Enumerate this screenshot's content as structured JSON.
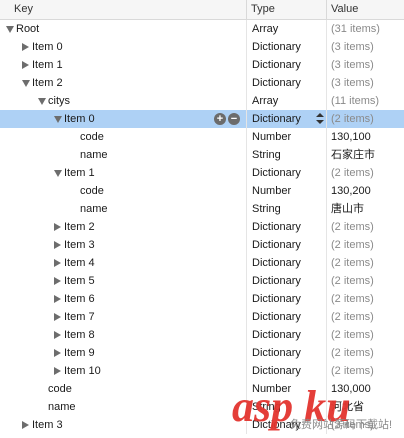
{
  "columns": {
    "key": "Key",
    "type": "Type",
    "value": "Value"
  },
  "rows": [
    {
      "key": "Root",
      "type": "Array",
      "value": "(31 items)",
      "indent": 0,
      "disclosure": "expanded",
      "muted": true
    },
    {
      "key": "Item 0",
      "type": "Dictionary",
      "value": "(3 items)",
      "indent": 1,
      "disclosure": "collapsed",
      "muted": true
    },
    {
      "key": "Item 1",
      "type": "Dictionary",
      "value": "(3 items)",
      "indent": 1,
      "disclosure": "collapsed",
      "muted": true
    },
    {
      "key": "Item 2",
      "type": "Dictionary",
      "value": "(3 items)",
      "indent": 1,
      "disclosure": "expanded",
      "muted": true
    },
    {
      "key": "citys",
      "type": "Array",
      "value": "(11 items)",
      "indent": 2,
      "disclosure": "expanded",
      "muted": true
    },
    {
      "key": "Item 0",
      "type": "Dictionary",
      "value": "(2 items)",
      "indent": 3,
      "disclosure": "expanded",
      "muted": true,
      "selected": true
    },
    {
      "key": "code",
      "type": "Number",
      "value": "130,100",
      "indent": 4,
      "disclosure": "none",
      "muted": false
    },
    {
      "key": "name",
      "type": "String",
      "value": "石家庄市",
      "indent": 4,
      "disclosure": "none",
      "muted": false
    },
    {
      "key": "Item 1",
      "type": "Dictionary",
      "value": "(2 items)",
      "indent": 3,
      "disclosure": "expanded",
      "muted": true
    },
    {
      "key": "code",
      "type": "Number",
      "value": "130,200",
      "indent": 4,
      "disclosure": "none",
      "muted": false
    },
    {
      "key": "name",
      "type": "String",
      "value": "唐山市",
      "indent": 4,
      "disclosure": "none",
      "muted": false
    },
    {
      "key": "Item 2",
      "type": "Dictionary",
      "value": "(2 items)",
      "indent": 3,
      "disclosure": "collapsed",
      "muted": true
    },
    {
      "key": "Item 3",
      "type": "Dictionary",
      "value": "(2 items)",
      "indent": 3,
      "disclosure": "collapsed",
      "muted": true
    },
    {
      "key": "Item 4",
      "type": "Dictionary",
      "value": "(2 items)",
      "indent": 3,
      "disclosure": "collapsed",
      "muted": true
    },
    {
      "key": "Item 5",
      "type": "Dictionary",
      "value": "(2 items)",
      "indent": 3,
      "disclosure": "collapsed",
      "muted": true
    },
    {
      "key": "Item 6",
      "type": "Dictionary",
      "value": "(2 items)",
      "indent": 3,
      "disclosure": "collapsed",
      "muted": true
    },
    {
      "key": "Item 7",
      "type": "Dictionary",
      "value": "(2 items)",
      "indent": 3,
      "disclosure": "collapsed",
      "muted": true
    },
    {
      "key": "Item 8",
      "type": "Dictionary",
      "value": "(2 items)",
      "indent": 3,
      "disclosure": "collapsed",
      "muted": true
    },
    {
      "key": "Item 9",
      "type": "Dictionary",
      "value": "(2 items)",
      "indent": 3,
      "disclosure": "collapsed",
      "muted": true
    },
    {
      "key": "Item 10",
      "type": "Dictionary",
      "value": "(2 items)",
      "indent": 3,
      "disclosure": "collapsed",
      "muted": true
    },
    {
      "key": "code",
      "type": "Number",
      "value": "130,000",
      "indent": 2,
      "disclosure": "none",
      "muted": false
    },
    {
      "key": "name",
      "type": "String",
      "value": "河北省",
      "indent": 2,
      "disclosure": "none",
      "muted": false
    },
    {
      "key": "Item 3",
      "type": "Dictionary",
      "value": "(3 items)",
      "indent": 1,
      "disclosure": "collapsed",
      "muted": true
    }
  ],
  "row_controls": {
    "add_label": "+",
    "remove_label": "−"
  },
  "watermark": {
    "logo": "asp ku",
    "subtitle": "免费网站源码下载站!"
  },
  "colors": {
    "selection": "#aed1f5",
    "muted_text": "#8a8a8a",
    "watermark": "#e3342f"
  }
}
